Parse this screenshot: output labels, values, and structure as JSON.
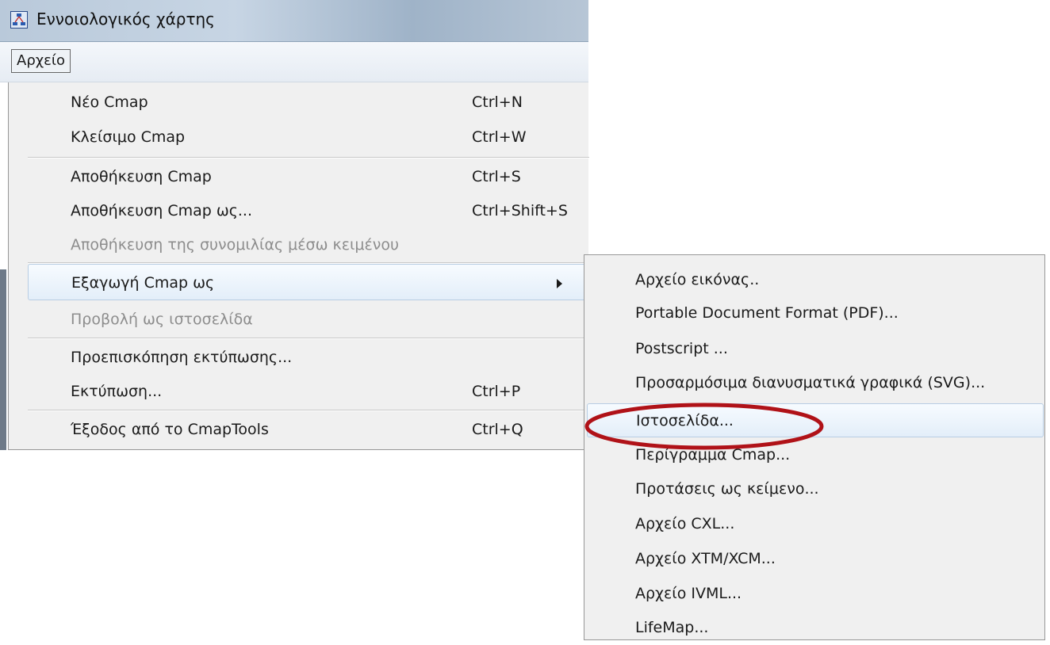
{
  "window": {
    "title": "Εννοιολογικός χάρτης",
    "icon": "cmap-app-icon"
  },
  "menubar": {
    "active_menu": "Αρχείο"
  },
  "file_menu": {
    "items": [
      {
        "label": "Νέο Cmap",
        "shortcut": "Ctrl+N",
        "enabled": true
      },
      {
        "label": "Κλείσιμο Cmap",
        "shortcut": "Ctrl+W",
        "enabled": true
      },
      {
        "label": "Αποθήκευση Cmap",
        "shortcut": "Ctrl+S",
        "enabled": true
      },
      {
        "label": "Αποθήκευση Cmap ως...",
        "shortcut": "Ctrl+Shift+S",
        "enabled": true
      },
      {
        "label": "Αποθήκευση της συνομιλίας μέσω κειμένου",
        "shortcut": "",
        "enabled": false
      },
      {
        "label": "Εξαγωγή Cmap ως",
        "shortcut": "",
        "enabled": true,
        "submenu": true,
        "highlighted": true
      },
      {
        "label": "Προβολή ως ιστοσελίδα",
        "shortcut": "",
        "enabled": false
      },
      {
        "label": "Προεπισκόπηση εκτύπωσης...",
        "shortcut": "",
        "enabled": true
      },
      {
        "label": "Εκτύπωση...",
        "shortcut": "Ctrl+P",
        "enabled": true
      },
      {
        "label": "Έξοδος από το CmapTools",
        "shortcut": "Ctrl+Q",
        "enabled": true
      }
    ]
  },
  "export_submenu": {
    "items": [
      {
        "label": "Αρχείο εικόνας.."
      },
      {
        "label": "Portable Document Format (PDF)..."
      },
      {
        "label": "Postscript ..."
      },
      {
        "label": "Προσαρμόσιμα διανυσματικά γραφικά (SVG)..."
      },
      {
        "label": "Ιστοσελίδα...",
        "highlighted": true,
        "circled": true
      },
      {
        "label": "Περίγραμμα Cmap..."
      },
      {
        "label": "Προτάσεις ως κείμενο..."
      },
      {
        "label": "Αρχείο CXL..."
      },
      {
        "label": "Αρχείο XTM/XCM..."
      },
      {
        "label": "Αρχείο IVML..."
      },
      {
        "label": "LifeMap..."
      }
    ]
  },
  "colors": {
    "annotation": "#b01218",
    "menu_bg": "#f0f0f0",
    "highlight_border": "#b8cde3"
  }
}
